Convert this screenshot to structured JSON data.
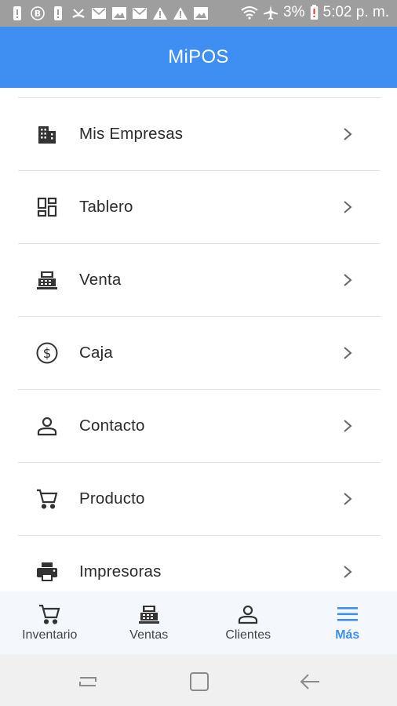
{
  "status_bar": {
    "battery": "3%",
    "time": "5:02 p. m.",
    "left_icons": [
      "alert-icon",
      "b-circle-icon",
      "alert-icon",
      "missed-call-icon",
      "mail-icon",
      "image-icon",
      "mail-icon",
      "warning-icon",
      "warning-icon",
      "image-icon"
    ],
    "right_icons": [
      "wifi-icon",
      "airplane-icon",
      "battery-low-icon"
    ]
  },
  "app_bar": {
    "title": "MiPOS"
  },
  "menu": {
    "items": [
      {
        "label": "Mis Empresas",
        "icon": "building-icon"
      },
      {
        "label": "Tablero",
        "icon": "dashboard-icon"
      },
      {
        "label": "Venta",
        "icon": "cash-register-icon"
      },
      {
        "label": "Caja",
        "icon": "dollar-circle-icon"
      },
      {
        "label": "Contacto",
        "icon": "person-icon"
      },
      {
        "label": "Producto",
        "icon": "cart-icon"
      },
      {
        "label": "Impresoras",
        "icon": "printer-icon"
      }
    ]
  },
  "bottom_nav": {
    "tabs": [
      {
        "label": "Inventario",
        "icon": "cart-icon"
      },
      {
        "label": "Ventas",
        "icon": "cash-register-icon"
      },
      {
        "label": "Clientes",
        "icon": "person-icon"
      },
      {
        "label": "Más",
        "icon": "menu-icon",
        "active": true
      }
    ]
  },
  "colors": {
    "primary": "#3f8ff3",
    "status_bar": "#9e9e9e",
    "nav_background": "#f4f8fd",
    "divider": "#e3e3e3"
  }
}
